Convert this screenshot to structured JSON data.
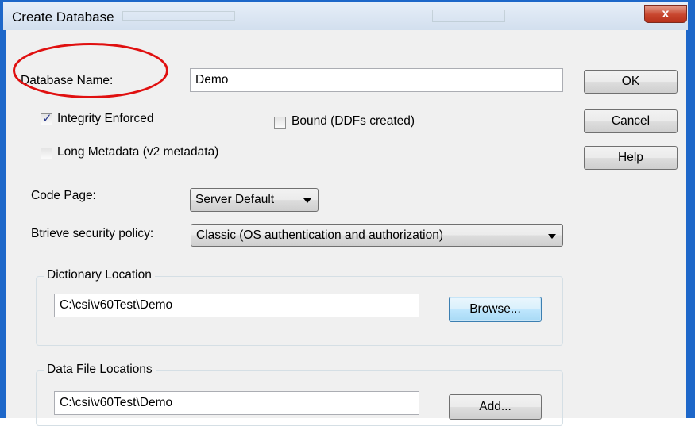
{
  "window": {
    "title": "Create Database",
    "close_glyph": "x"
  },
  "form": {
    "db_name_label": "Database Name:",
    "db_name_value": "Demo",
    "integrity_label": "Integrity Enforced",
    "integrity_checked": true,
    "bound_label": "Bound (DDFs created)",
    "bound_checked": false,
    "long_meta_label": "Long Metadata (v2 metadata)",
    "long_meta_checked": false,
    "code_page_label": "Code Page:",
    "code_page_value": "Server Default",
    "security_label": "Btrieve security policy:",
    "security_value": "Classic (OS authentication and authorization)"
  },
  "buttons": {
    "ok": "OK",
    "cancel": "Cancel",
    "help": "Help"
  },
  "dictionary": {
    "group_label": "Dictionary Location",
    "path": "C:\\csi\\v60Test\\Demo",
    "browse_label": "Browse..."
  },
  "data_files": {
    "group_label": "Data File Locations",
    "path": "C:\\csi\\v60Test\\Demo",
    "add_label": "Add..."
  },
  "colors": {
    "frame": "#1d67c9",
    "highlight_circle": "#e01010"
  }
}
